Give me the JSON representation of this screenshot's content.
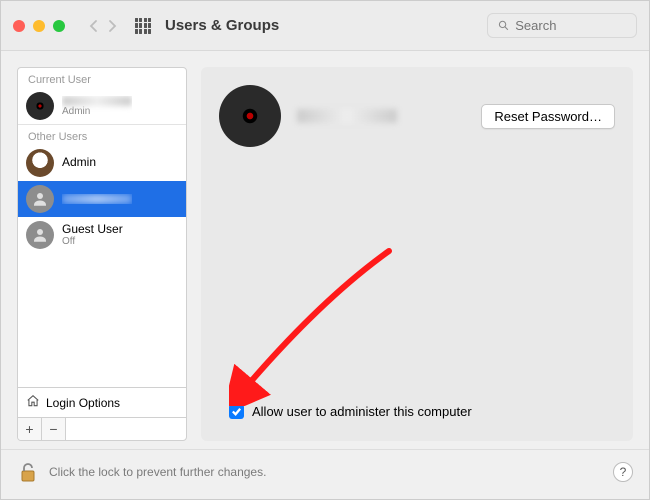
{
  "titlebar": {
    "title": "Users & Groups",
    "search_placeholder": "Search"
  },
  "sidebar": {
    "sections": {
      "current_label": "Current User",
      "other_label": "Other Users"
    },
    "current_user": {
      "name": "████",
      "role": "Admin"
    },
    "other_users": [
      {
        "name": "Admin",
        "role": "",
        "avatar": "eagle",
        "selected": false
      },
      {
        "name": "████",
        "role": "",
        "avatar": "gray",
        "selected": true
      },
      {
        "name": "Guest User",
        "role": "Off",
        "avatar": "gray",
        "selected": false
      }
    ],
    "login_options": "Login Options"
  },
  "detail": {
    "username": "████████",
    "reset_button": "Reset Password…",
    "admin_checkbox_label": "Allow user to administer this computer",
    "admin_checked": true
  },
  "footer": {
    "lock_text": "Click the lock to prevent further changes."
  }
}
